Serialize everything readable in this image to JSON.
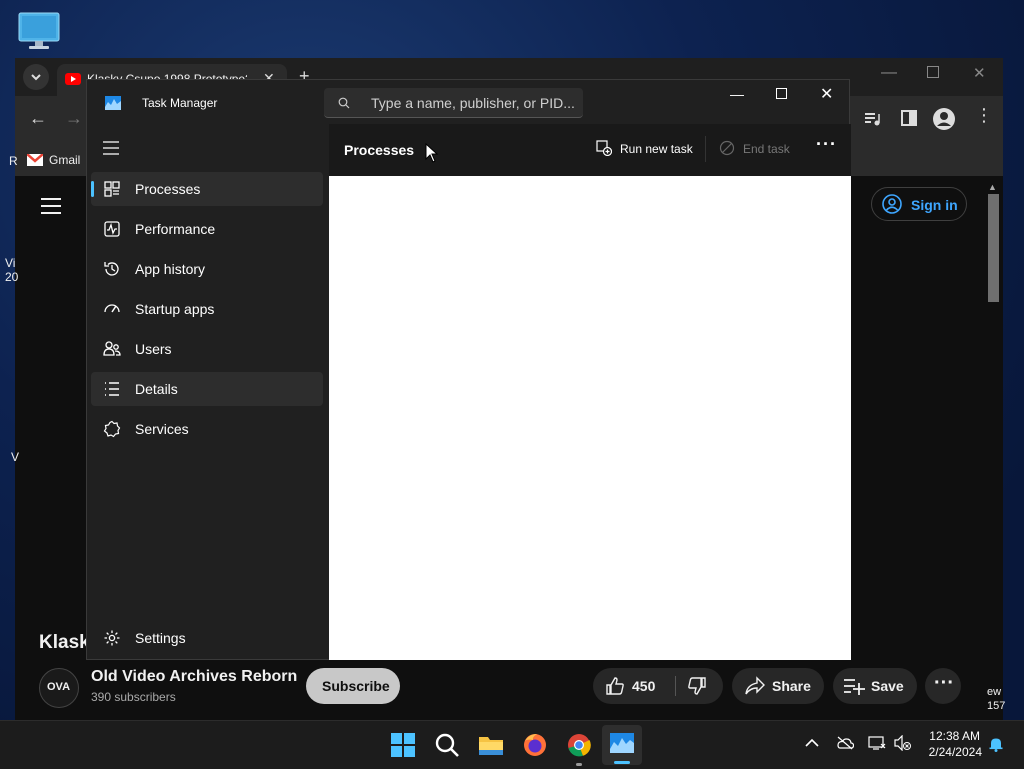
{
  "browser": {
    "tab_title": "Klasky Csupo 1998 Prototype?",
    "bookmark_gmail": "Gmail",
    "bookmark_partial": "R"
  },
  "youtube": {
    "signin_label": "Sign in",
    "video_title_partial": "Klask",
    "channel_name": "Old Video Archives Reborn",
    "subscribers": "390 subscribers",
    "subscribe_label": "Subscribe",
    "like_count": "450",
    "share_label": "Share",
    "save_label": "Save",
    "avatar_text": "OVA",
    "left_edge_text_1": "Vi",
    "left_edge_text_2": "20",
    "left_edge_text_3": "V",
    "right_edge_text_1": "ew",
    "right_edge_text_2": "157"
  },
  "task_manager": {
    "title": "Task Manager",
    "search_placeholder": "Type a name, publisher, or PID...",
    "page_title": "Processes",
    "run_new_task": "Run new task",
    "end_task": "End task",
    "nav": [
      {
        "label": "Processes",
        "icon": "processes-icon"
      },
      {
        "label": "Performance",
        "icon": "performance-icon"
      },
      {
        "label": "App history",
        "icon": "app-history-icon"
      },
      {
        "label": "Startup apps",
        "icon": "startup-apps-icon"
      },
      {
        "label": "Users",
        "icon": "users-icon"
      },
      {
        "label": "Details",
        "icon": "details-icon"
      },
      {
        "label": "Services",
        "icon": "services-icon"
      }
    ],
    "settings_label": "Settings"
  },
  "taskbar": {
    "time": "12:38 AM",
    "date": "2/24/2024"
  },
  "colors": {
    "accent": "#4cc2ff",
    "signin_blue": "#3ea6ff"
  }
}
